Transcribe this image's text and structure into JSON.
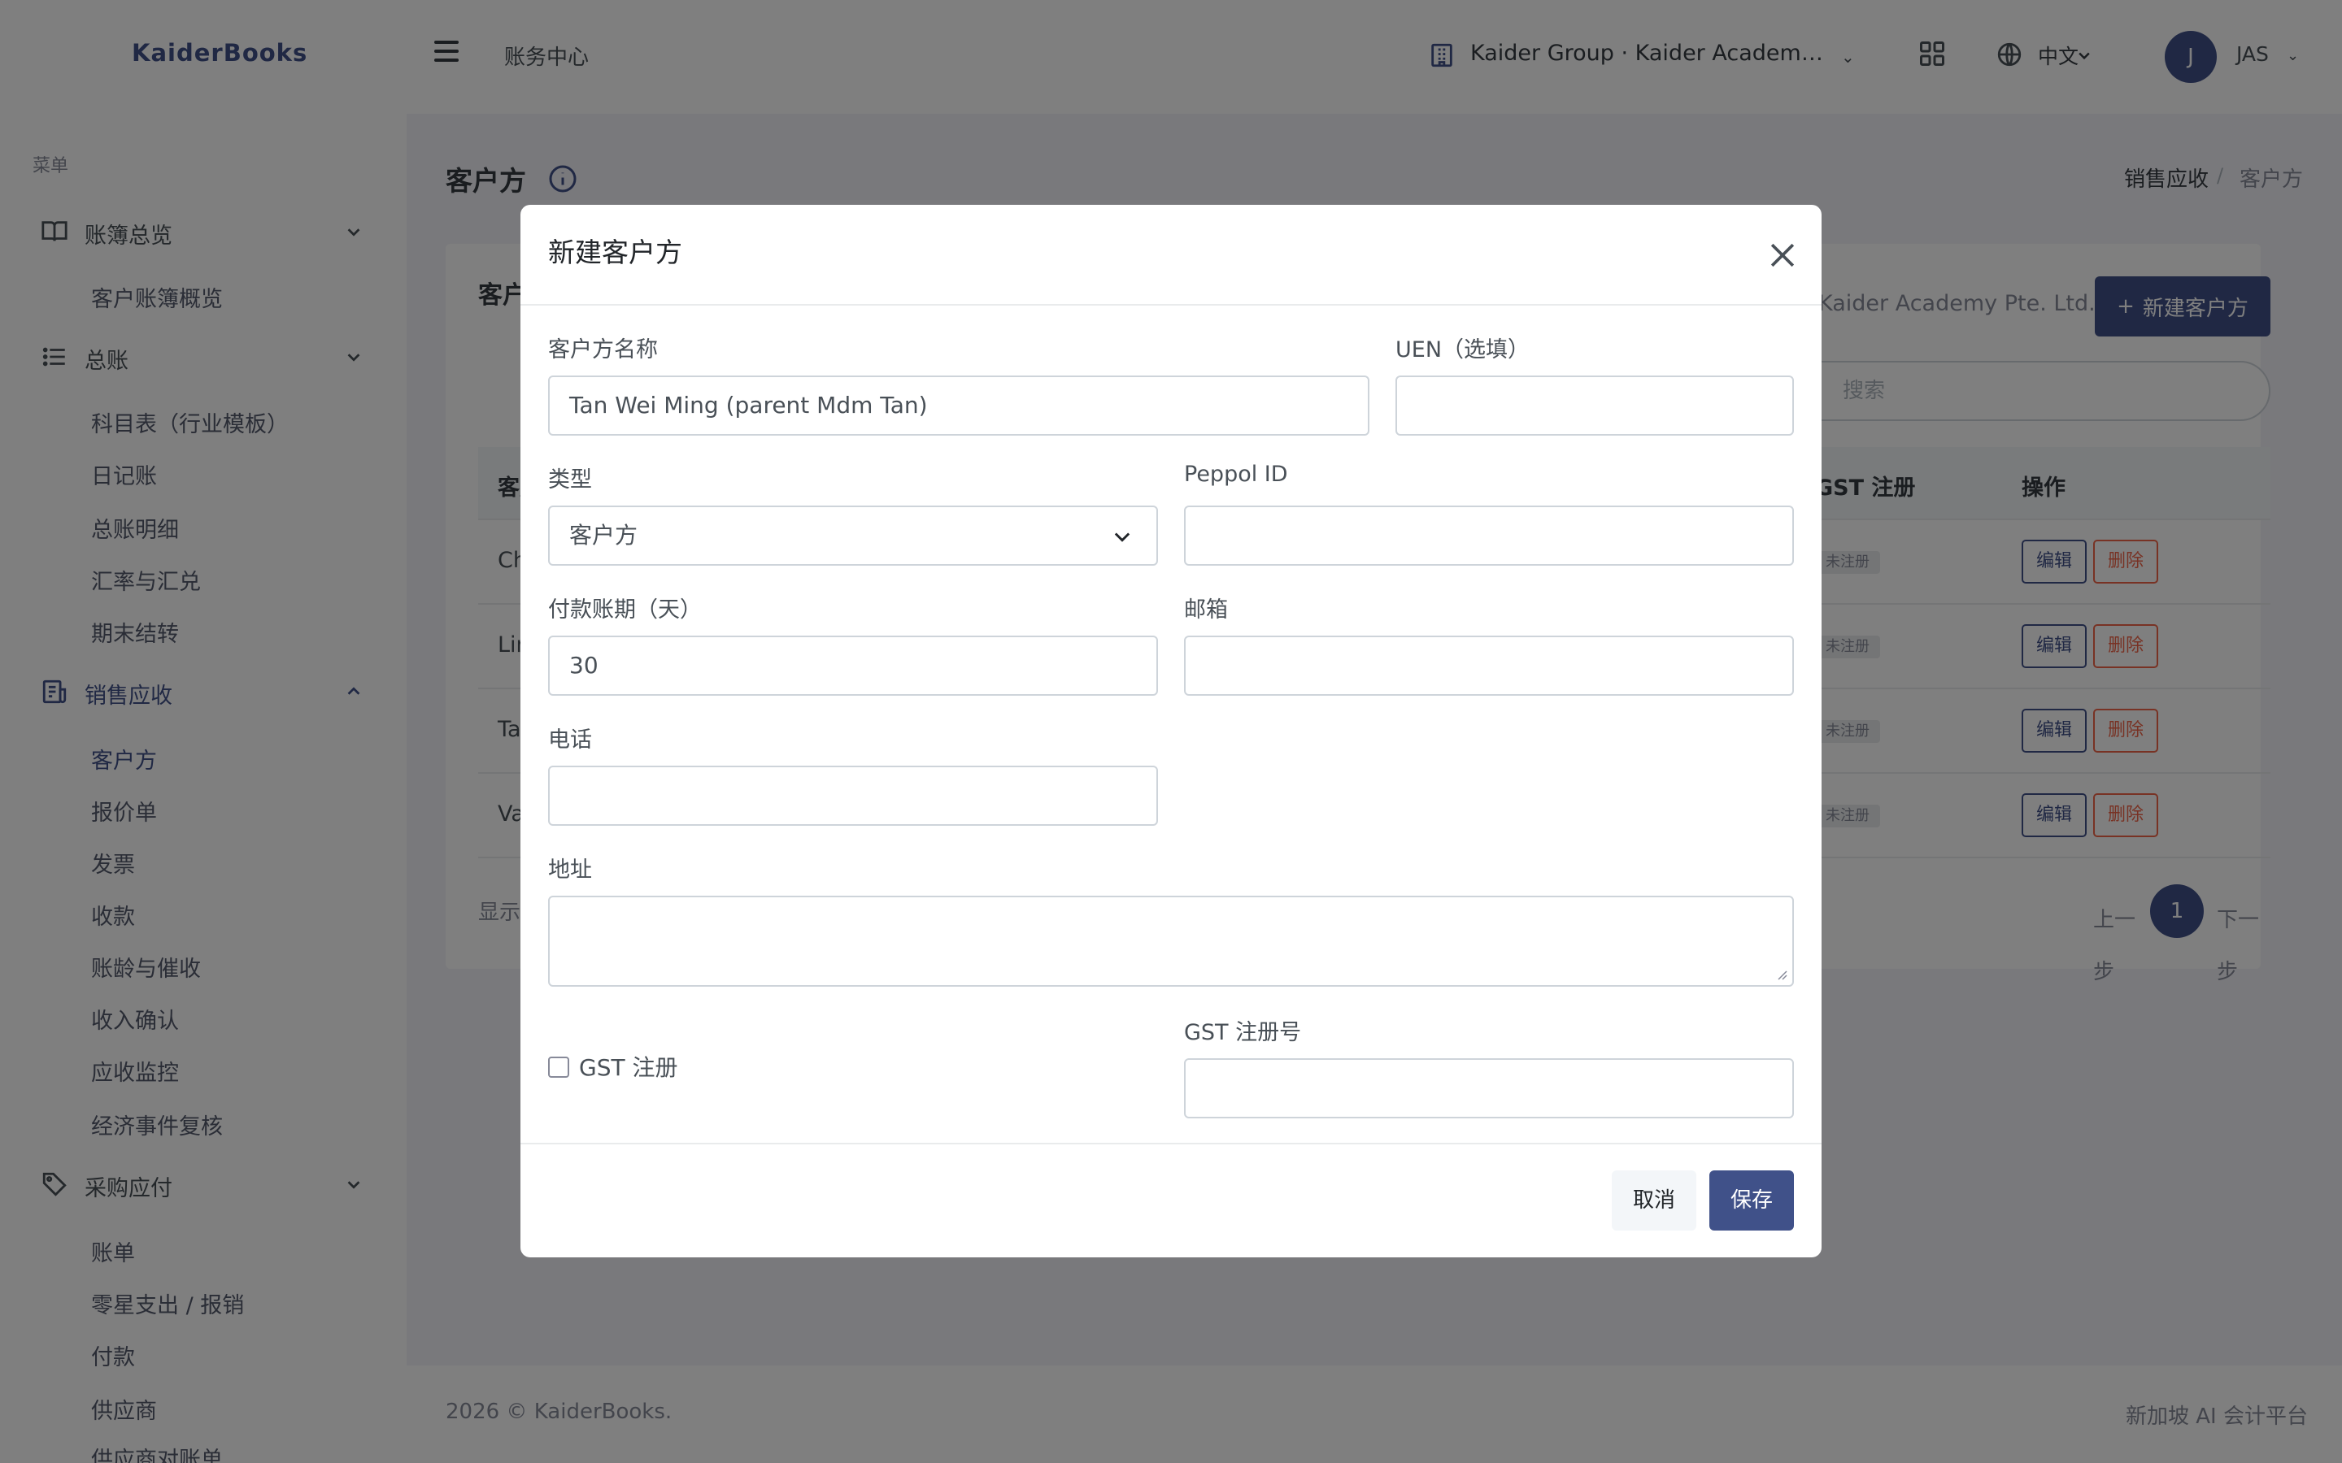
{
  "header": {
    "logo": "KaiderBooks",
    "breadcrumb": "账务中心",
    "org_name": "Kaider Group · Kaider Academy ...",
    "lang": "中文",
    "avatar_initial": "J",
    "user": "JAS"
  },
  "sidebar": {
    "menu_title": "菜单",
    "sections": [
      {
        "label": "账簿总览",
        "icon": "book-icon",
        "expanded": true,
        "items": [
          "客户账簿概览"
        ]
      },
      {
        "label": "总账",
        "icon": "list-icon",
        "expanded": true,
        "items": [
          "科目表（行业模板）",
          "日记账",
          "总账明细",
          "汇率与汇兑",
          "期末结转"
        ]
      },
      {
        "label": "销售应收",
        "icon": "receipt-icon",
        "expanded": true,
        "active": true,
        "items": [
          "客户方",
          "报价单",
          "发票",
          "收款",
          "账龄与催收",
          "收入确认",
          "应收监控",
          "经济事件复核"
        ],
        "active_item": "客户方"
      },
      {
        "label": "采购应付",
        "icon": "tag-icon",
        "expanded": true,
        "items": [
          "账单",
          "零星支出 / 报销",
          "付款",
          "供应商",
          "供应商对账单"
        ]
      }
    ]
  },
  "page": {
    "title": "客户方",
    "breadcrumb": [
      "销售应收",
      "客户方"
    ],
    "card_title": "客户",
    "org_label": "Kaider Academy Pte. Ltd.",
    "new_button": "新建客户方",
    "search_placeholder": "搜索",
    "table": {
      "headers": [
        "客户",
        "GST 注册",
        "操作"
      ],
      "rows": [
        {
          "name": "Ch",
          "gst": "未注册",
          "edit": "编辑",
          "delete": "删除"
        },
        {
          "name": "Lin",
          "gst": "未注册",
          "edit": "编辑",
          "delete": "删除"
        },
        {
          "name": "Ta",
          "gst": "未注册",
          "edit": "编辑",
          "delete": "删除"
        },
        {
          "name": "Va",
          "gst": "未注册",
          "edit": "编辑",
          "delete": "删除"
        }
      ]
    },
    "showing_text": "显示",
    "pagination": {
      "prev": "上一步",
      "current": "1",
      "next": "下一步"
    }
  },
  "footer": {
    "copyright": "2026 © KaiderBooks.",
    "tagline": "新加坡 AI 会计平台"
  },
  "modal": {
    "title": "新建客户方",
    "name_label": "客户方名称",
    "name_value": "Tan Wei Ming (parent Mdm Tan)",
    "uen_label": "UEN（选填）",
    "uen_value": "",
    "type_label": "类型",
    "type_value": "客户方",
    "peppol_label": "Peppol ID",
    "peppol_value": "",
    "terms_label": "付款账期（天）",
    "terms_value": "30",
    "email_label": "邮箱",
    "email_value": "",
    "phone_label": "电话",
    "phone_value": "",
    "address_label": "地址",
    "address_value": "",
    "gst_checkbox_label": "GST 注册",
    "gst_checked": false,
    "gst_no_label": "GST 注册号",
    "gst_no_value": "",
    "cancel_label": "取消",
    "save_label": "保存"
  },
  "colors": {
    "primary": "#405189",
    "danger": "#f06548",
    "overlay": "rgba(0,0,0,0.5)"
  }
}
